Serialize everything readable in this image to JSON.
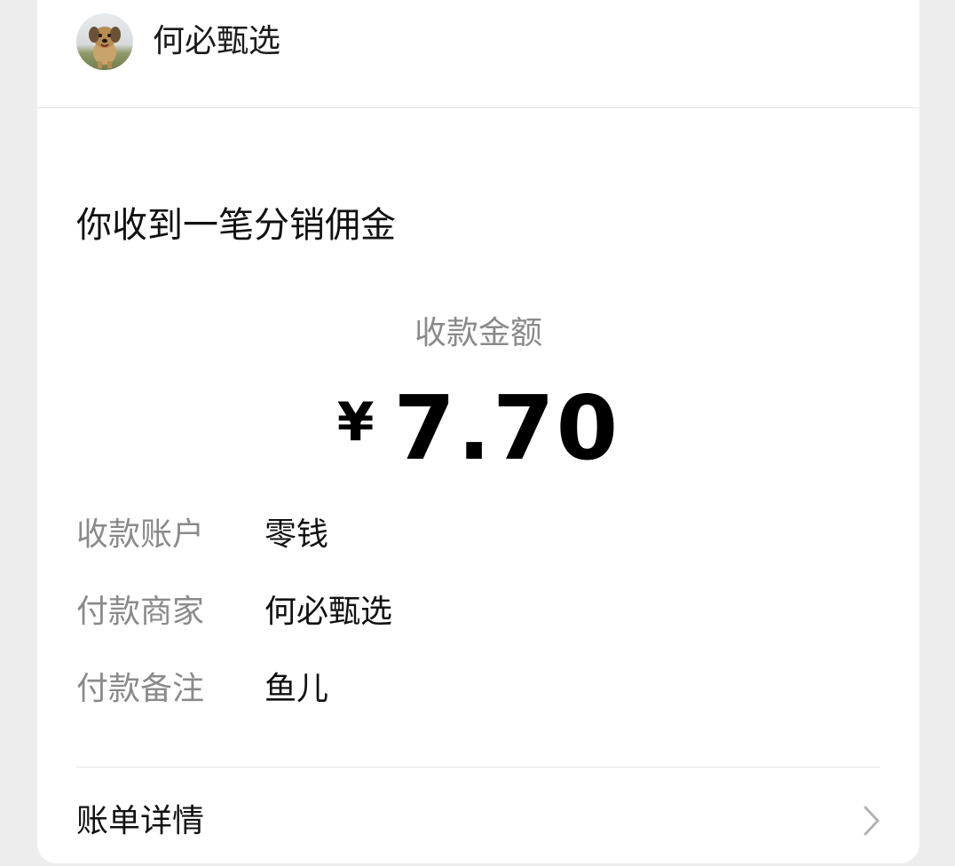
{
  "merchant": {
    "name": "何必甄选",
    "avatar_icon": "dog-avatar"
  },
  "notification": {
    "title": "你收到一笔分销佣金"
  },
  "amount": {
    "label": "收款金额",
    "currency": "¥",
    "value": "7.70"
  },
  "details": [
    {
      "label": "收款账户",
      "value": "零钱"
    },
    {
      "label": "付款商家",
      "value": "何必甄选"
    },
    {
      "label": "付款备注",
      "value": "鱼儿"
    }
  ],
  "footer": {
    "bill_details_label": "账单详情",
    "chevron_icon": "chevron-right-icon"
  }
}
